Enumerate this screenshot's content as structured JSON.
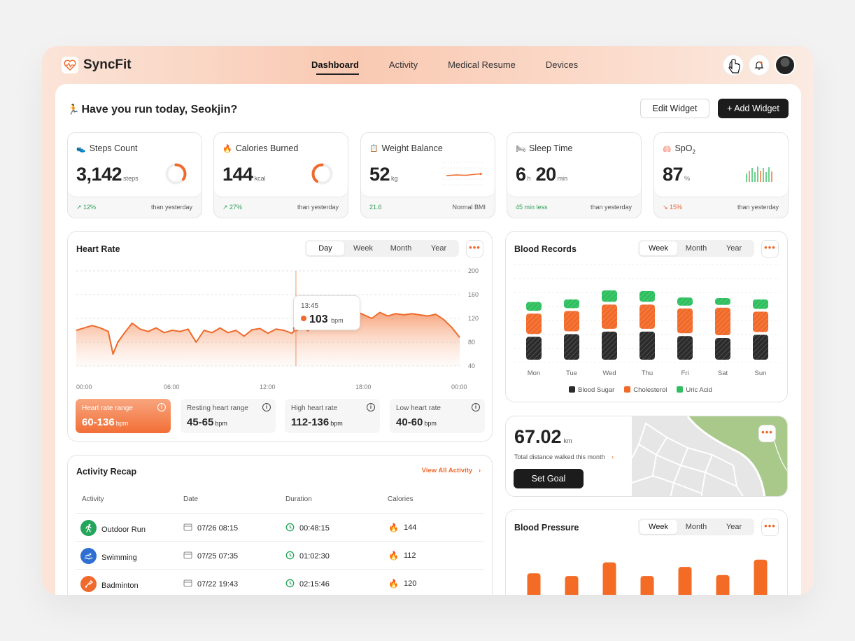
{
  "app": {
    "name": "SyncFit"
  },
  "nav": {
    "items": [
      "Dashboard",
      "Activity",
      "Medical Resume",
      "Devices"
    ],
    "active": "Dashboard"
  },
  "header": {
    "greeting": "Have you run today, Seokjin?",
    "edit_widget": "Edit Widget",
    "add_widget": "+ Add Widget"
  },
  "stats": [
    {
      "title": "Steps Count",
      "value": "3,142",
      "unit": "steps",
      "change": "12%",
      "change_dir": "up",
      "note": "than yesterday",
      "progress": 0.35,
      "icon": "shoe-icon"
    },
    {
      "title": "Calories Burned",
      "value": "144",
      "unit": "kcal",
      "change": "27%",
      "change_dir": "up",
      "note": "than yesterday",
      "progress": 0.4,
      "icon": "flame-icon"
    },
    {
      "title": "Weight Balance",
      "value": "52",
      "unit": "kg",
      "change": "21.6",
      "change_dir": "up",
      "note": "Normal BMI",
      "icon": "scale-icon"
    },
    {
      "title": "Sleep Time",
      "value_h": "6",
      "unit_h": "h",
      "value_m": "20",
      "unit_m": "min",
      "change": "45 min less",
      "change_dir": "up",
      "note": "than yesterday",
      "icon": "bed-icon"
    },
    {
      "title": "SpO",
      "title_sub": "2",
      "value": "87",
      "unit": "%",
      "change": "15%",
      "change_dir": "down",
      "note": "than yesterday",
      "icon": "spo2-icon"
    }
  ],
  "heart_rate": {
    "title": "Heart Rate",
    "tabs": [
      "Day",
      "Week",
      "Month",
      "Year"
    ],
    "active_tab": "Day",
    "tooltip": {
      "time": "13:45",
      "value": "103",
      "unit": "bpm"
    },
    "ranges": [
      {
        "label": "Heart rate range",
        "value": "60-136",
        "unit": "bpm",
        "active": true
      },
      {
        "label": "Resting heart range",
        "value": "45-65",
        "unit": "bpm"
      },
      {
        "label": "High heart rate",
        "value": "112-136",
        "unit": "bpm"
      },
      {
        "label": "Low heart rate",
        "value": "40-60",
        "unit": "bpm"
      }
    ]
  },
  "blood_records": {
    "title": "Blood Records",
    "tabs": [
      "Week",
      "Month",
      "Year"
    ],
    "active_tab": "Week",
    "legend": [
      "Blood Sugar",
      "Cholesterol",
      "Uric Acid"
    ]
  },
  "distance": {
    "value": "67.02",
    "unit": "km",
    "label": "Total distance walked this month",
    "button": "Set Goal"
  },
  "blood_pressure": {
    "title": "Blood Pressure",
    "tabs": [
      "Week",
      "Month",
      "Year"
    ],
    "active_tab": "Week"
  },
  "activity_recap": {
    "title": "Activity Recap",
    "view_all": "View All Activity",
    "columns": [
      "Activity",
      "Date",
      "Duration",
      "Calories"
    ],
    "rows": [
      {
        "activity": "Outdoor Run",
        "date": "07/26 08:15",
        "duration": "00:48:15",
        "calories": "144",
        "color": "#23a55a"
      },
      {
        "activity": "Swimming",
        "date": "07/25 07:35",
        "duration": "01:02:30",
        "calories": "112",
        "color": "#2f6fd1"
      },
      {
        "activity": "Badminton",
        "date": "07/22 19:43",
        "duration": "02:15:46",
        "calories": "120",
        "color": "#ef6a2c"
      }
    ]
  },
  "colors": {
    "accent": "#ef6a2c",
    "green": "#2fbf5f",
    "dark": "#1c1c1c"
  },
  "chart_data": [
    {
      "type": "area",
      "title": "Heart Rate",
      "x_ticks": [
        "00:00",
        "06:00",
        "12:00",
        "18:00",
        "00:00"
      ],
      "y_ticks": [
        "200",
        "160",
        "120",
        "80",
        "40"
      ],
      "ylim": [
        40,
        200
      ],
      "x": [
        0,
        0.5,
        1,
        1.5,
        2,
        2.3,
        2.6,
        3,
        3.5,
        4,
        4.5,
        5,
        5.5,
        6,
        6.5,
        7,
        7.5,
        8,
        8.5,
        9,
        9.5,
        10,
        10.5,
        11,
        11.5,
        12,
        12.5,
        13,
        13.5,
        13.75,
        14,
        14.5,
        15,
        15.5,
        16,
        16.5,
        17,
        17.5,
        18,
        18.5,
        19,
        19.5,
        20,
        20.5,
        21,
        21.5,
        22,
        22.5,
        23,
        23.5,
        24
      ],
      "y": [
        100,
        104,
        108,
        104,
        98,
        60,
        80,
        95,
        112,
        102,
        98,
        104,
        96,
        100,
        98,
        102,
        80,
        100,
        96,
        104,
        96,
        100,
        90,
        101,
        103,
        95,
        102,
        100,
        95,
        103,
        108,
        99,
        110,
        104,
        122,
        138,
        120,
        132,
        126,
        120,
        130,
        124,
        128,
        126,
        128,
        126,
        124,
        127,
        118,
        105,
        88
      ],
      "tooltip_x": 13.75
    },
    {
      "type": "bar",
      "title": "Blood Records",
      "stacked": true,
      "categories": [
        "Mon",
        "Tue",
        "Wed",
        "Thu",
        "Fri",
        "Sat",
        "Sun"
      ],
      "series": [
        {
          "name": "Blood Sugar",
          "values": [
            40,
            44,
            48,
            48,
            41,
            38,
            43
          ],
          "color": "#2b2b2b"
        },
        {
          "name": "Cholesterol",
          "values": [
            36,
            36,
            42,
            42,
            43,
            47,
            36
          ],
          "color": "#f26a2a"
        },
        {
          "name": "Uric Acid",
          "values": [
            18,
            18,
            22,
            21,
            17,
            15,
            19
          ],
          "color": "#2fbf5f"
        }
      ]
    },
    {
      "type": "bar",
      "title": "Blood Pressure",
      "values": [
        46,
        43,
        58,
        43,
        53,
        44,
        61
      ]
    }
  ]
}
